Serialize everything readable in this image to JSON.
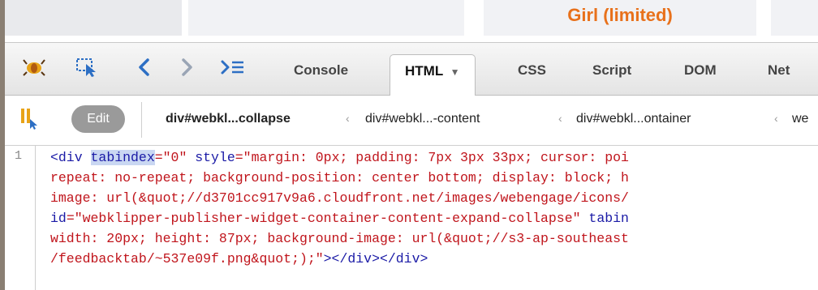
{
  "webpage": {
    "heading": "Girl (limited)"
  },
  "toolbar": {
    "icons": [
      "firebug-icon",
      "inspect-icon",
      "back-icon",
      "forward-icon",
      "command-line-icon"
    ],
    "tabs": [
      "Console",
      "HTML",
      "CSS",
      "Script",
      "DOM",
      "Net"
    ],
    "active_tab": "HTML"
  },
  "breadcrumb": {
    "edit_label": "Edit",
    "items": [
      "div#webkl...collapse",
      "div#webkl...-content",
      "div#webkl...ontainer",
      "we"
    ]
  },
  "code": {
    "line_number": "1",
    "lines": [
      [
        "tag",
        "<div "
      ],
      [
        "attr_hl",
        "tabindex"
      ],
      [
        "val",
        "=\"0\" "
      ],
      [
        "attr",
        "style"
      ],
      [
        "val",
        "=\"margin: 0px; padding: 7px 3px 33px; cursor: poi"
      ],
      [
        "nl",
        ""
      ],
      [
        "val",
        "repeat: no-repeat; background-position: center bottom; display: block; h"
      ],
      [
        "nl",
        ""
      ],
      [
        "val",
        "image: url(&quot;//d3701cc917v9a6.cloudfront.net/images/webengage/icons/"
      ],
      [
        "nl",
        ""
      ],
      [
        "attr",
        "id"
      ],
      [
        "val",
        "=\"webklipper-publisher-widget-container-content-expand-collapse\" "
      ],
      [
        "attr",
        "tabin"
      ],
      [
        "nl",
        ""
      ],
      [
        "val",
        "width: 20px; height: 87px; background-image: url(&quot;//s3-ap-southeast"
      ],
      [
        "nl",
        ""
      ],
      [
        "val",
        "/feedbacktab/~537e09f.png&quot;);\""
      ],
      [
        "tag",
        "></div></div>"
      ]
    ]
  }
}
